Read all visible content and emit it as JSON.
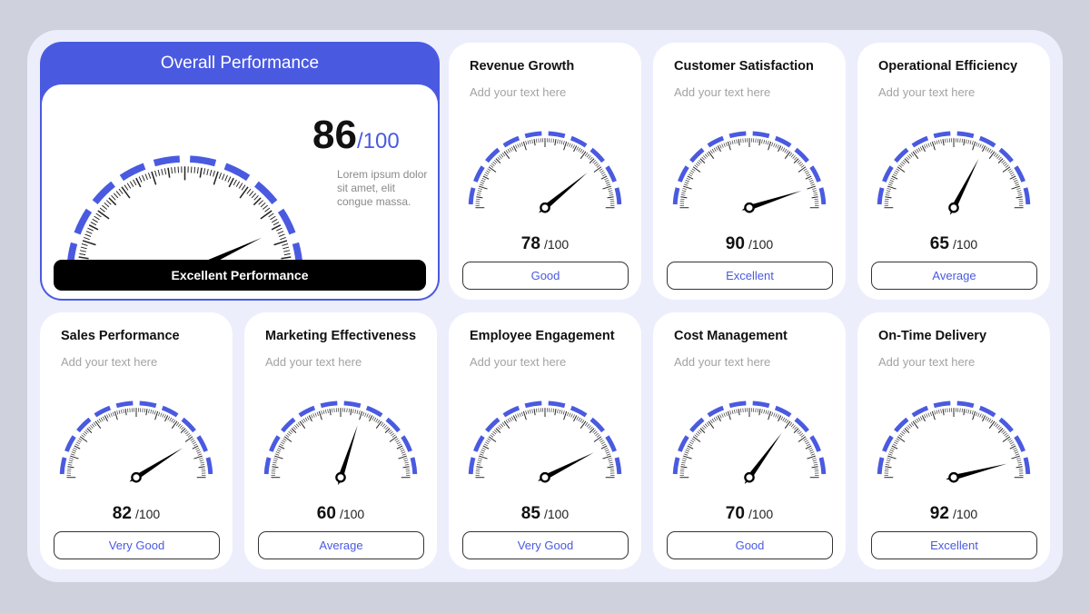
{
  "colors": {
    "accent": "#4a5ae0",
    "tick": "#222222",
    "needle": "#000000"
  },
  "overall": {
    "title": "Overall Performance",
    "score": "86",
    "out_of": "/100",
    "value": 86,
    "description": "Lorem ipsum dolor sit amet, elit congue massa.",
    "status": "Excellent Performance"
  },
  "cards": [
    {
      "title": "Revenue Growth",
      "subtitle": "Add your text here",
      "score": "78",
      "out_of": "/100",
      "value": 78,
      "status": "Good"
    },
    {
      "title": "Customer Satisfaction",
      "subtitle": "Add your text here",
      "score": "90",
      "out_of": "/100",
      "value": 90,
      "status": "Excellent"
    },
    {
      "title": "Operational Efficiency",
      "subtitle": "Add your text here",
      "score": "65",
      "out_of": "/100",
      "value": 65,
      "status": "Average"
    },
    {
      "title": "Sales Performance",
      "subtitle": "Add your text here",
      "score": "82",
      "out_of": "/100",
      "value": 82,
      "status": "Very Good"
    },
    {
      "title": "Marketing Effectiveness",
      "subtitle": "Add your text here",
      "score": "60",
      "out_of": "/100",
      "value": 60,
      "status": "Average"
    },
    {
      "title": "Employee Engagement",
      "subtitle": "Add your text here",
      "score": "85",
      "out_of": "/100",
      "value": 85,
      "status": "Very Good"
    },
    {
      "title": "Cost Management",
      "subtitle": "Add your text here",
      "score": "70",
      "out_of": "/100",
      "value": 70,
      "status": "Good"
    },
    {
      "title": "On-Time Delivery",
      "subtitle": "Add your text here",
      "score": "92",
      "out_of": "/100",
      "value": 92,
      "status": "Excellent"
    }
  ]
}
